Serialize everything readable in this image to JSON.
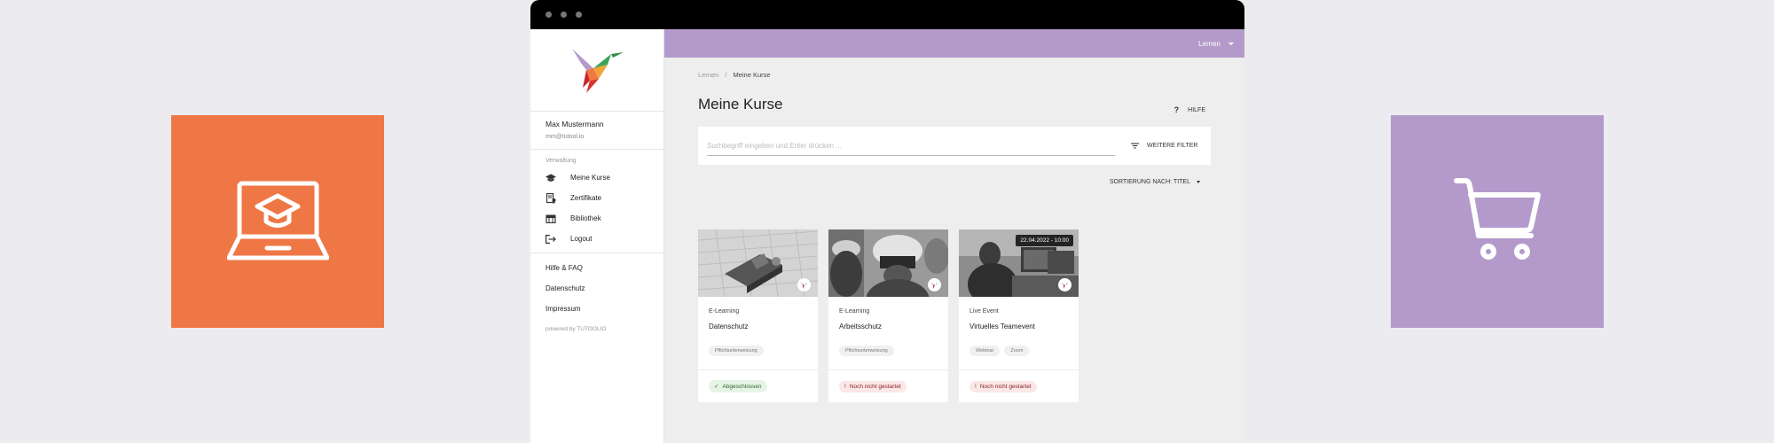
{
  "app": {
    "topbar": {
      "language_label": "Lernen"
    },
    "brand": {
      "name": "TUTOOLIO"
    },
    "user": {
      "name": "Max Mustermann",
      "email": "mm@tutool.io"
    },
    "sidebar": {
      "section_label": "Verwaltung",
      "items": [
        {
          "label": "Meine Kurse",
          "icon": "graduation-cap-icon"
        },
        {
          "label": "Zertifikate",
          "icon": "certificate-icon"
        },
        {
          "label": "Bibliothek",
          "icon": "library-icon"
        },
        {
          "label": "Logout",
          "icon": "logout-icon"
        }
      ],
      "links": [
        "Hilfe & FAQ",
        "Datenschutz",
        "Impressum"
      ],
      "powered_by": "powered by TUTOOLIO"
    },
    "breadcrumb": {
      "root": "Lernen",
      "separator": "/",
      "current": "Meine Kurse"
    },
    "page_title": "Meine Kurse",
    "help_label": "HILFE",
    "search": {
      "placeholder": "Suchbegriff eingeben und Enter drücken ...",
      "value": ""
    },
    "filter_label": "WEITERE FILTER",
    "sort_label": "SORTIERUNG NACH: TITEL",
    "courses": [
      {
        "type": "E-Learning",
        "title": "Datenschutz",
        "tags": [
          "Pflichtunterweisung"
        ],
        "status": "Abgeschlossen",
        "status_kind": "done",
        "date": ""
      },
      {
        "type": "E-Learning",
        "title": "Arbeitsschutz",
        "tags": [
          "Pflichtunterweisung"
        ],
        "status": "Noch nicht gestartet",
        "status_kind": "todo",
        "date": ""
      },
      {
        "type": "Live Event",
        "title": "Virtuelles Teamevent",
        "tags": [
          "Webinar",
          "Zoom"
        ],
        "status": "Noch nicht gestartet",
        "status_kind": "todo",
        "date": "22.04.2022 - 10:00"
      }
    ]
  },
  "decor": {
    "left_tile": {
      "color": "#ef7645",
      "icon": "laptop-graduation-icon"
    },
    "right_tile": {
      "color": "#b49acb",
      "icon": "shopping-cart-icon"
    }
  },
  "colors": {
    "accent": "#b49acb",
    "orange": "#ef7645",
    "done": "#2b6a2b",
    "todo": "#8a2222"
  }
}
